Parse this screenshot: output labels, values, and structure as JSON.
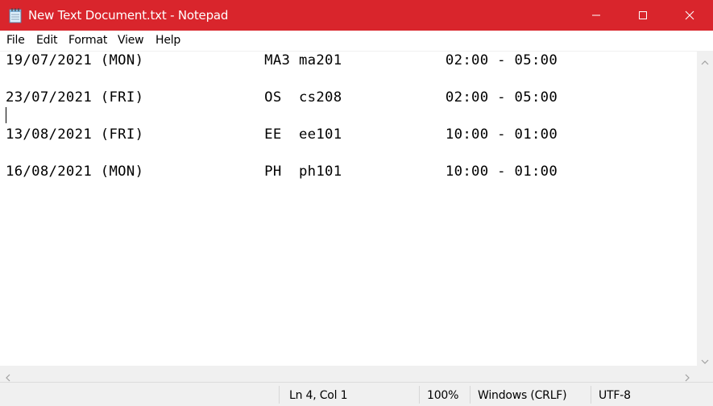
{
  "window": {
    "title": "New Text Document.txt - Notepad",
    "accent_color": "#d9252c"
  },
  "menu": {
    "items": [
      "File",
      "Edit",
      "Format",
      "View",
      "Help"
    ]
  },
  "document": {
    "lines": [
      "19/07/2021 (MON)              MA3 ma201            02:00 - 05:00",
      "",
      "23/07/2021 (FRI)              OS  cs208            02:00 - 05:00",
      "",
      "13/08/2021 (FRI)              EE  ee101            10:00 - 01:00",
      "",
      "16/08/2021 (MON)              PH  ph101            10:00 - 01:00"
    ]
  },
  "status": {
    "position": "Ln 4, Col 1",
    "zoom": "100%",
    "line_ending": "Windows (CRLF)",
    "encoding": "UTF-8"
  }
}
